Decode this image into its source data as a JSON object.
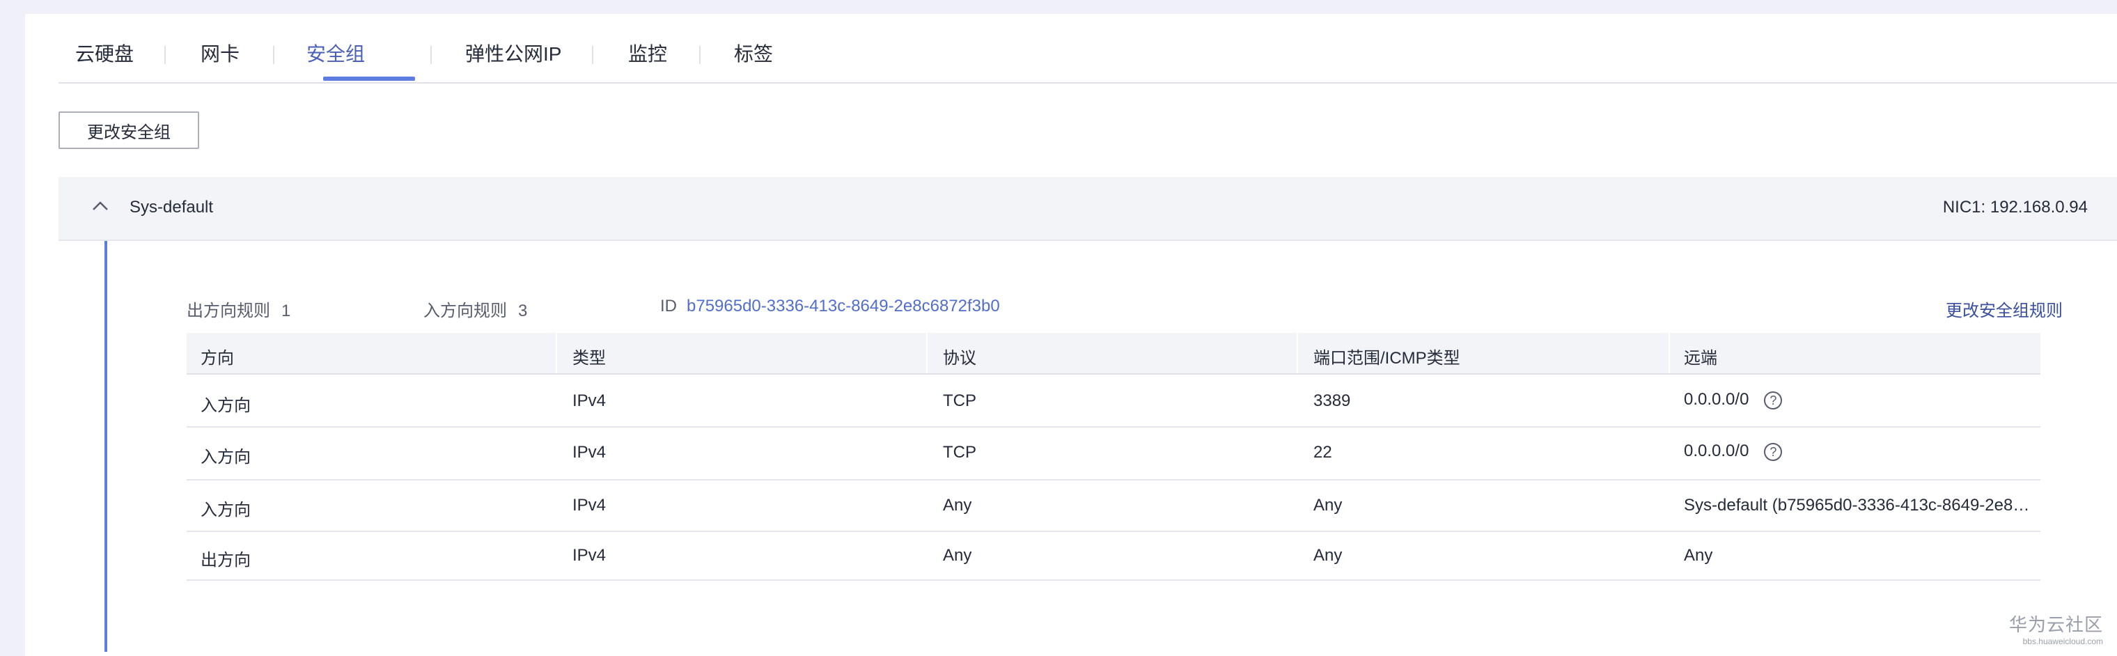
{
  "tabs": [
    {
      "label": "云硬盘"
    },
    {
      "label": "网卡"
    },
    {
      "label": "安全组"
    },
    {
      "label": "弹性公网IP"
    },
    {
      "label": "监控"
    },
    {
      "label": "标签"
    }
  ],
  "active_tab": "安全组",
  "actions": {
    "change_security_group": "更改安全组"
  },
  "group": {
    "name": "Sys-default",
    "nic": "NIC1: 192.168.0.94",
    "outbound_label": "出方向规则",
    "outbound_count": "1",
    "inbound_label": "入方向规则",
    "inbound_count": "3",
    "id_label": "ID",
    "id_value": "b75965d0-3336-413c-8649-2e8c6872f3b0",
    "edit_rules": "更改安全组规则"
  },
  "table": {
    "headers": [
      "方向",
      "类型",
      "协议",
      "端口范围/ICMP类型",
      "远端"
    ],
    "rows": [
      [
        "入方向",
        "IPv4",
        "TCP",
        "3389",
        "0.0.0.0/0"
      ],
      [
        "入方向",
        "IPv4",
        "TCP",
        "22",
        "0.0.0.0/0"
      ],
      [
        "入方向",
        "IPv4",
        "Any",
        "Any",
        "Sys-default (b75965d0-3336-413c-8649-2e8…"
      ],
      [
        "出方向",
        "IPv4",
        "Any",
        "Any",
        "Any"
      ]
    ]
  },
  "icons": {
    "collapse": "chevron-up-icon",
    "help": "question-circle-icon"
  },
  "watermark": {
    "line1": "华为云社区",
    "line2": "bbs.huaweicloud.com"
  },
  "colors": {
    "accent": "#5e7ce0",
    "link": "#526ecc",
    "background": "#f0f1f8"
  }
}
